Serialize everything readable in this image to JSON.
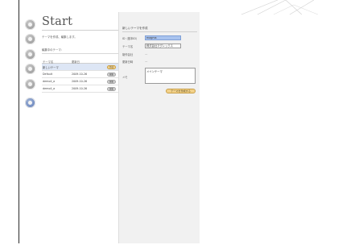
{
  "page": {
    "title": "Start",
    "instruction": "テーマを作成、編集します。",
    "subheading": "編集中のテーマ："
  },
  "theme_table": {
    "headers": [
      "テーマ名",
      "更新日"
    ],
    "rows": [
      {
        "name": "新しいテーマ",
        "date": "",
        "action": "作成",
        "selected": true
      },
      {
        "name": "Default",
        "date": "2009-10-26",
        "action": "編集",
        "selected": false
      },
      {
        "name": "demo4_a",
        "date": "2009-10-26",
        "action": "編集",
        "selected": false
      },
      {
        "name": "demo4_a",
        "date": "2009-10-26",
        "action": "編集",
        "selected": false
      }
    ]
  },
  "form": {
    "title": "新しいテーマを作成",
    "fields": {
      "id_label": "ID（基本ID）",
      "id_value": "magma",
      "theme_label": "テーマ名",
      "theme_value": "株式会社マグレックス",
      "creator_label": "制作会社",
      "creator_value": "—",
      "updated_label": "更新日時",
      "updated_value": "—",
      "memo_label": "メモ",
      "memo_value": "メインテーマ"
    },
    "submit_label": "テーマを作成する"
  },
  "colors": {
    "accent_gold": "#f3d28a",
    "selection_blue": "#dde6f5",
    "field_highlight": "#a9c3ee",
    "active_step": "#5a78b8"
  }
}
